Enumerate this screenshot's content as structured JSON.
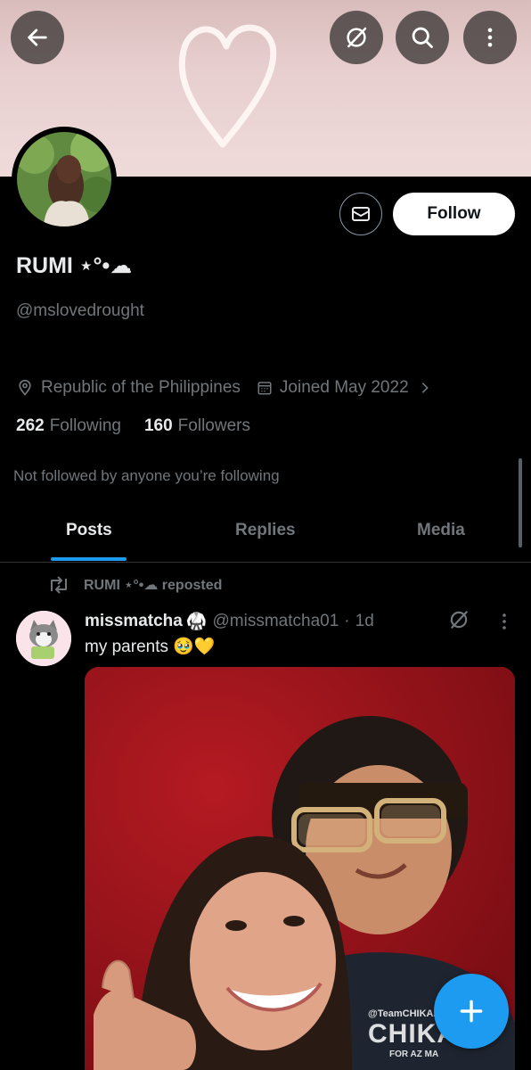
{
  "profile": {
    "display_name": "RUMI ⋆°•☁︎",
    "handle": "@mslovedrought",
    "location": "Republic of the Philippines",
    "joined": "Joined May 2022",
    "following_count": "262",
    "following_label": "Following",
    "followers_count": "160",
    "followers_label": "Followers",
    "not_followed_text": "Not followed by anyone you’re following"
  },
  "actions": {
    "follow_label": "Follow"
  },
  "tabs": [
    {
      "label": "Posts",
      "active": true
    },
    {
      "label": "Replies",
      "active": false
    },
    {
      "label": "Media",
      "active": false
    }
  ],
  "post": {
    "repost_text": "RUMI ⋆°•☁︎ reposted",
    "author_name": "missmatcha",
    "author_emoji": "🥋",
    "author_handle": "@missmatcha01",
    "separator": "·",
    "time": "1d",
    "text": "my parents 🥹💛",
    "watermark_top": "@TeamCHIKAZ",
    "watermark_main": "CHIKA",
    "watermark_sub": "FOR AZ MA"
  },
  "colors": {
    "accent": "#1d9bf0",
    "background": "#000000",
    "muted": "#71767b"
  },
  "icons": [
    "back-arrow-icon",
    "grok-icon",
    "search-icon",
    "more-vertical-icon",
    "mail-icon",
    "location-pin-icon",
    "calendar-icon",
    "chevron-right-icon",
    "repost-icon",
    "plus-icon"
  ]
}
